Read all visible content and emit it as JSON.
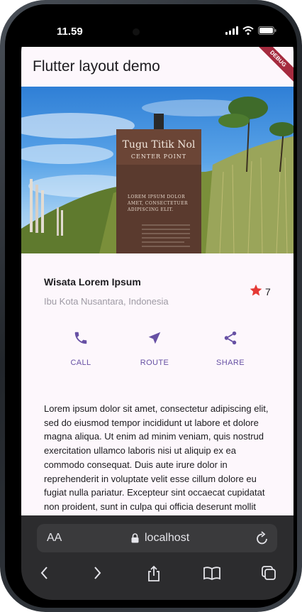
{
  "status_bar": {
    "time": "11.59"
  },
  "app_bar": {
    "title": "Flutter layout demo",
    "debug_banner": "DEBUG"
  },
  "hero": {
    "sign_title": "Tugu Titik Nol",
    "sign_subtitle": "CENTER POINT",
    "sign_line_1": "LOREM IPSUM DOLOR",
    "sign_line_2": "AMET, CONSECTETUER",
    "sign_line_3": "ADIPISCING ELIT."
  },
  "title_section": {
    "name": "Wisata Lorem Ipsum",
    "location": "Ibu Kota Nusantara, Indonesia",
    "rating": "7"
  },
  "actions": [
    {
      "label": "CALL",
      "icon": "phone-icon"
    },
    {
      "label": "ROUTE",
      "icon": "navigation-icon"
    },
    {
      "label": "SHARE",
      "icon": "share-icon"
    }
  ],
  "description": "Lorem ipsum dolor sit amet, consectetur adipiscing elit, sed do eiusmod tempor incididunt ut labore et dolore magna aliqua. Ut enim ad minim veniam, quis nostrud exercitation ullamco laboris nisi ut aliquip ex ea commodo consequat. Duis aute irure dolor in reprehenderit in voluptate velit esse cillum dolore eu fugiat nulla pariatur. Excepteur sint occaecat cupidatat non proident, sunt in culpa qui officia deserunt mollit anim id",
  "browser": {
    "text_size_label": "AA",
    "url": "localhost"
  },
  "colors": {
    "accent": "#6750a4",
    "star": "#e53935",
    "app_background": "#fdf7fc",
    "debug_banner": "#a52b3f"
  }
}
